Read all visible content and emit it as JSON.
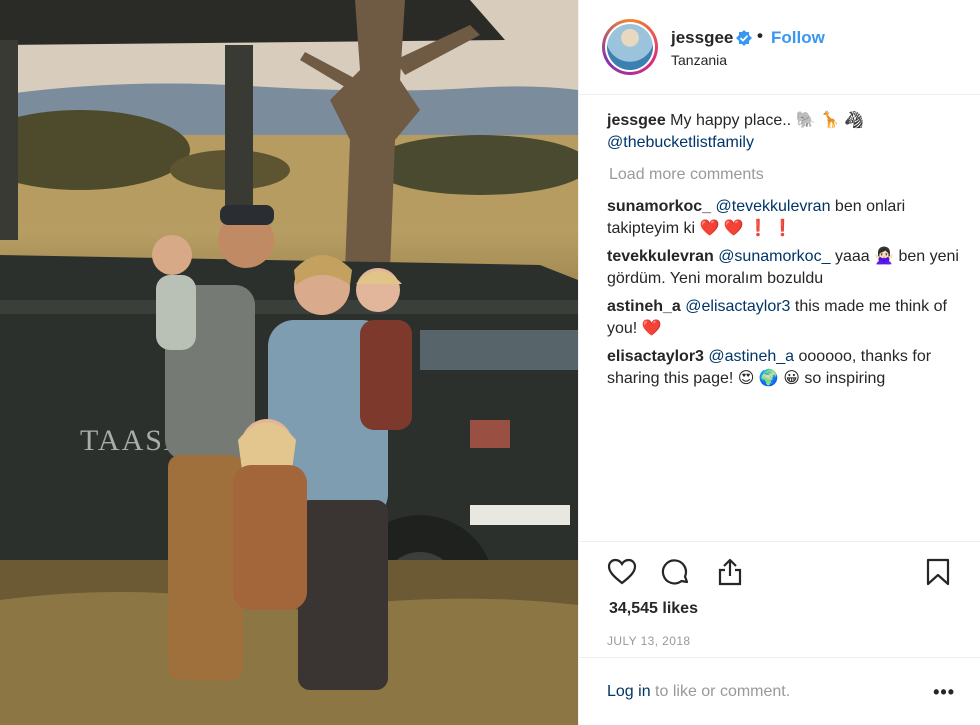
{
  "post": {
    "username": "jessgee",
    "separator": "•",
    "follow_label": "Follow",
    "location": "Tanzania",
    "photo_vehicle_text": "TAASA"
  },
  "caption": {
    "username": "jessgee",
    "text": "My happy place.. 🐘 🦒 🦓",
    "mention": "@thebucketlistfamily"
  },
  "load_more_label": "Load more comments",
  "comments": [
    {
      "username": "sunamorkoc_",
      "mention": "@tevekkulevran",
      "text": "ben onlari takipteyim ki ❤️ ❤️ ❗ ❗"
    },
    {
      "username": "tevekkulevran",
      "mention": "@sunamorkoc_",
      "text": "yaaa 🙅🏻‍♀️ ben yeni gördüm. Yeni moralım bozuldu"
    },
    {
      "username": "astineh_a",
      "mention": "@elisactaylor3",
      "text": "this made me think of you! ❤️"
    },
    {
      "username": "elisactaylor3",
      "mention": "@astineh_a",
      "text": "oooooo, thanks for sharing this page! 😍 🌍 😀 so inspiring"
    }
  ],
  "actions": {
    "like_icon": "heart-outline-icon",
    "comment_icon": "speech-bubble-icon",
    "share_icon": "share-upload-icon",
    "save_icon": "bookmark-icon"
  },
  "likes": "34,545 likes",
  "date": "JULY 13, 2018",
  "add_comment": {
    "login_label": "Log in",
    "rest": " to like or comment.",
    "more": "•••"
  },
  "colors": {
    "link_blue": "#3897f0",
    "mention_navy": "#003569",
    "muted": "#999999",
    "text": "#262626",
    "verified": "#3897f0"
  }
}
